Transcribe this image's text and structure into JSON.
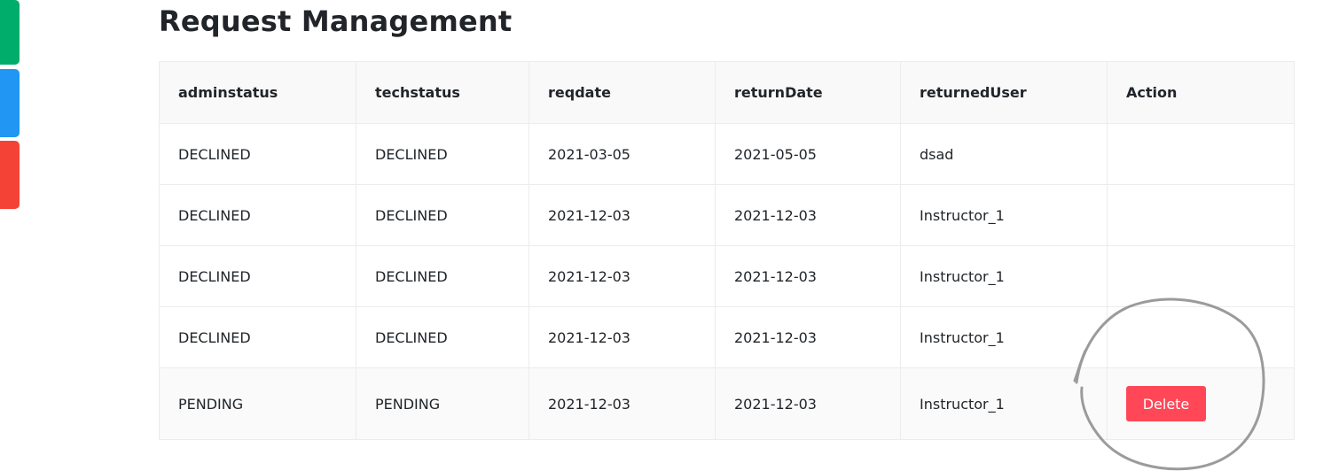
{
  "page_title": "Request Management",
  "table": {
    "headers": [
      "adminstatus",
      "techstatus",
      "reqdate",
      "returnDate",
      "returnedUser",
      "Action"
    ],
    "rows": [
      {
        "adminstatus": "DECLINED",
        "techstatus": "DECLINED",
        "reqdate": "2021-03-05",
        "returnDate": "2021-05-05",
        "returnedUser": "dsad",
        "action": ""
      },
      {
        "adminstatus": "DECLINED",
        "techstatus": "DECLINED",
        "reqdate": "2021-12-03",
        "returnDate": "2021-12-03",
        "returnedUser": "Instructor_1",
        "action": ""
      },
      {
        "adminstatus": "DECLINED",
        "techstatus": "DECLINED",
        "reqdate": "2021-12-03",
        "returnDate": "2021-12-03",
        "returnedUser": "Instructor_1",
        "action": ""
      },
      {
        "adminstatus": "DECLINED",
        "techstatus": "DECLINED",
        "reqdate": "2021-12-03",
        "returnDate": "2021-12-03",
        "returnedUser": "Instructor_1",
        "action": ""
      },
      {
        "adminstatus": "PENDING",
        "techstatus": "PENDING",
        "reqdate": "2021-12-03",
        "returnDate": "2021-12-03",
        "returnedUser": "Instructor_1",
        "action": "Delete"
      }
    ]
  },
  "colors": {
    "tab_green": "#00ad6b",
    "tab_blue": "#2196f3",
    "tab_red": "#f44336",
    "delete_button": "#ff4757"
  }
}
